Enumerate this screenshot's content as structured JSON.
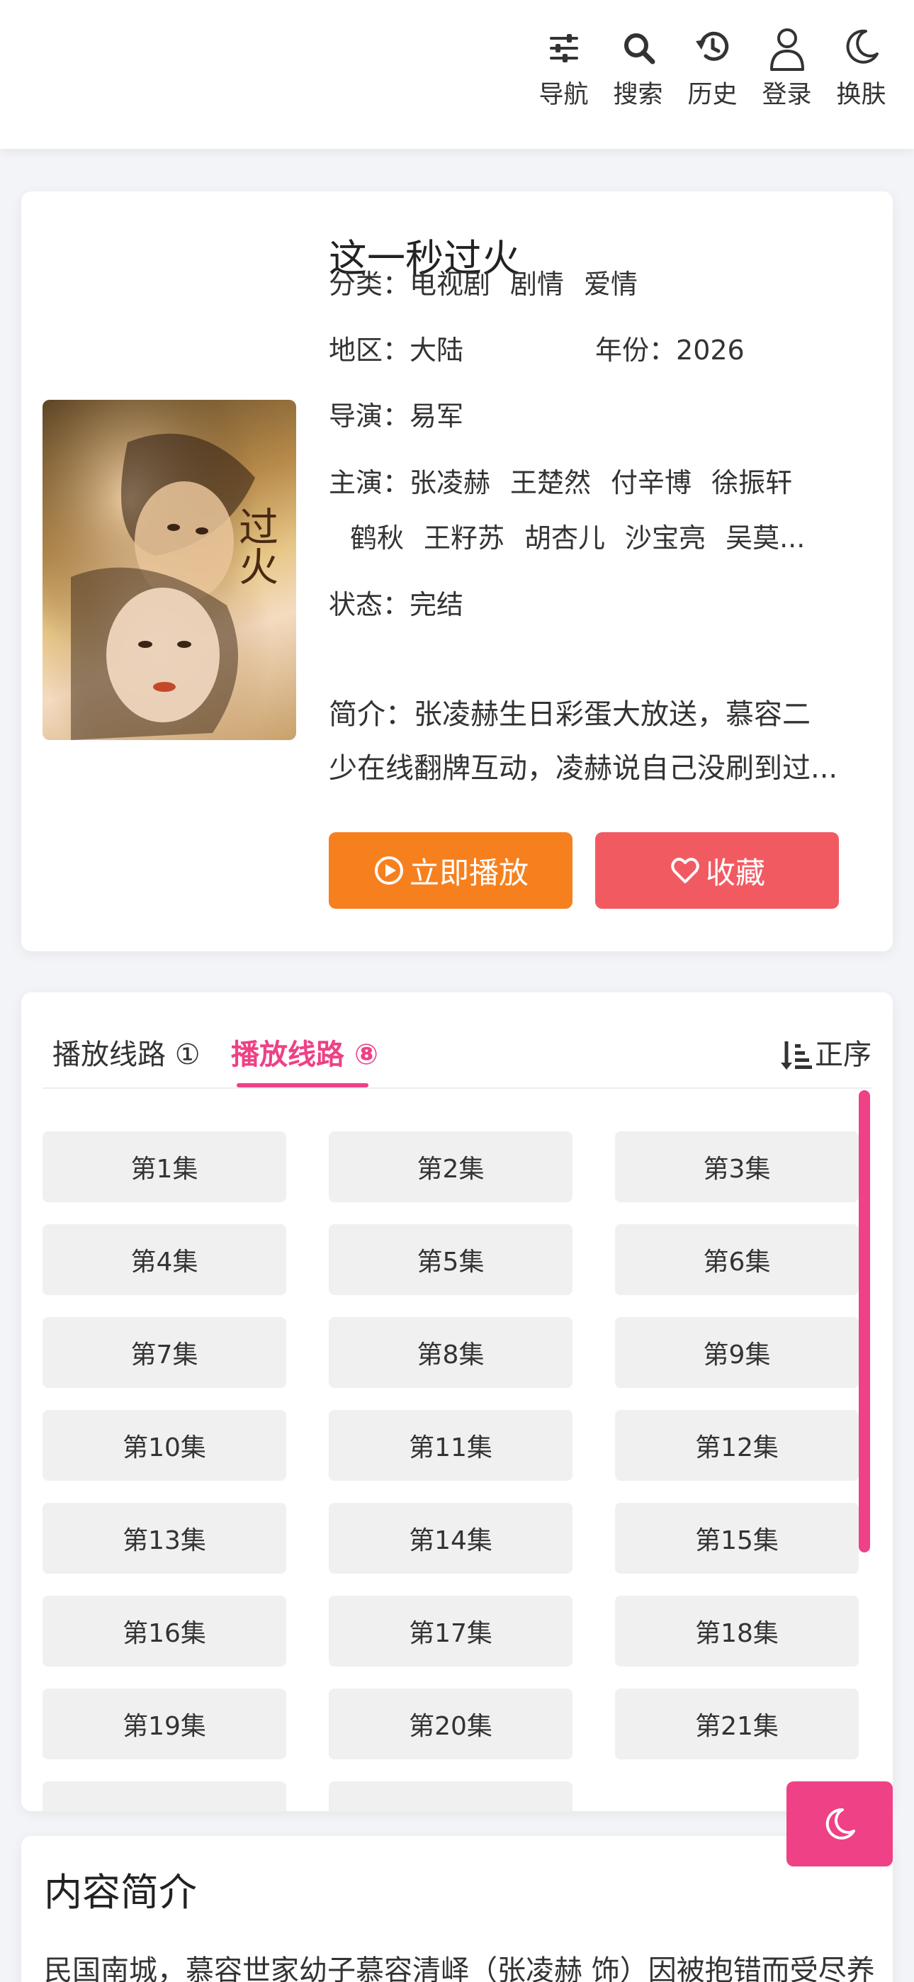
{
  "header": {
    "nav": [
      {
        "icon": "sliders-icon",
        "label": "导航"
      },
      {
        "icon": "search-icon",
        "label": "搜索"
      },
      {
        "icon": "history-icon",
        "label": "历史"
      },
      {
        "icon": "user-icon",
        "label": "登录"
      },
      {
        "icon": "moon-icon",
        "label": "换肤"
      }
    ]
  },
  "detail": {
    "title": "这一秒过火",
    "category_label": "分类：",
    "categories": [
      "电视剧",
      "剧情",
      "爱情"
    ],
    "region_label": "地区：",
    "region": "大陆",
    "year_label": "年份：",
    "year": "2026",
    "director_label": "导演：",
    "director": "易军",
    "cast_label": "主演：",
    "cast_line1": [
      "张凌赫",
      "王楚然",
      "付辛博",
      "徐振轩"
    ],
    "cast_line2": [
      "鹤秋",
      "王籽苏",
      "胡杏儿",
      "沙宝亮",
      "吴莫..."
    ],
    "status_label": "状态：",
    "status": "完结",
    "intro_line1": "简介：张凌赫生日彩蛋大放送，慕容二",
    "intro_line2": "少在线翻牌互动，凌赫说自己没刷到过...",
    "play_button": "立即播放",
    "favorite_button": "收藏",
    "poster_text": "过火"
  },
  "episodes": {
    "tabs": [
      {
        "label": "播放线路",
        "badge": "①",
        "active": false
      },
      {
        "label": "播放线路",
        "badge": "⑧",
        "active": true
      }
    ],
    "sort_label": "正序",
    "list": [
      "第1集",
      "第2集",
      "第3集",
      "第4集",
      "第5集",
      "第6集",
      "第7集",
      "第8集",
      "第9集",
      "第10集",
      "第11集",
      "第12集",
      "第13集",
      "第14集",
      "第15集",
      "第16集",
      "第17集",
      "第18集",
      "第19集",
      "第20集",
      "第21集",
      "",
      ""
    ]
  },
  "content_intro": {
    "title": "内容简介",
    "text": "民国南城，慕容世家幼子慕容清峄（张凌赫 饰）因被抱错而受尽养"
  },
  "colors": {
    "accent_pink": "#ee4186",
    "play_orange": "#f7801e",
    "favorite_red": "#f25a62"
  }
}
